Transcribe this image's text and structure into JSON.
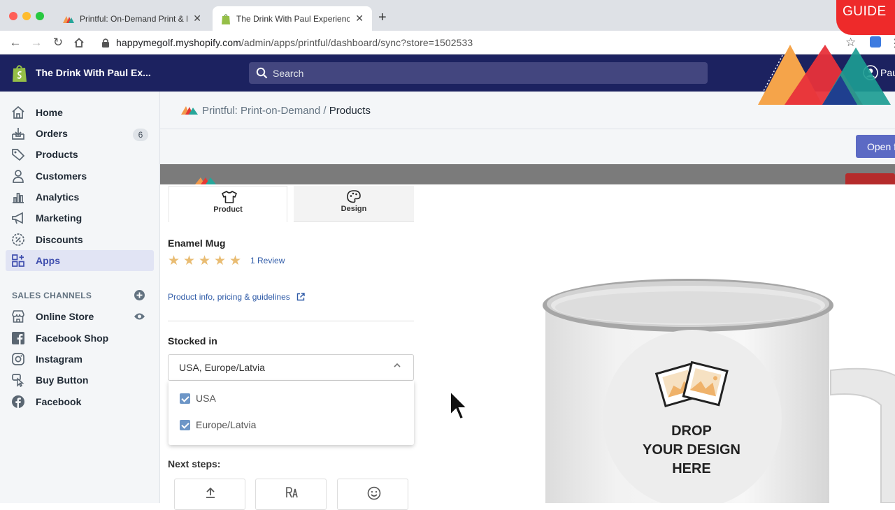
{
  "browser": {
    "tabs": [
      {
        "title": "Printful: On-Demand Print & En",
        "close": "✕"
      },
      {
        "title": "The Drink With Paul Experience",
        "close": "✕"
      }
    ],
    "new_tab": "+",
    "url_host": "happymegolf.myshopify.com",
    "url_path": "/admin/apps/printful/dashboard/sync?store=1502533"
  },
  "topbar": {
    "store_name": "The Drink With Paul Ex...",
    "search_placeholder": "Search",
    "user_name": "Pau"
  },
  "sidebar": {
    "items": [
      {
        "label": "Home",
        "icon": "home-icon"
      },
      {
        "label": "Orders",
        "icon": "orders-icon",
        "badge": "6"
      },
      {
        "label": "Products",
        "icon": "tag-icon"
      },
      {
        "label": "Customers",
        "icon": "person-icon"
      },
      {
        "label": "Analytics",
        "icon": "bar-chart-icon"
      },
      {
        "label": "Marketing",
        "icon": "megaphone-icon"
      },
      {
        "label": "Discounts",
        "icon": "discount-icon"
      },
      {
        "label": "Apps",
        "icon": "apps-icon",
        "active": true
      }
    ],
    "sales_channels_heading": "SALES CHANNELS",
    "channels": [
      {
        "label": "Online Store",
        "icon": "store-icon"
      },
      {
        "label": "Facebook Shop",
        "icon": "facebook-icon"
      },
      {
        "label": "Instagram",
        "icon": "instagram-icon"
      },
      {
        "label": "Buy Button",
        "icon": "buy-button-icon"
      },
      {
        "label": "Facebook",
        "icon": "facebook-round-icon"
      }
    ]
  },
  "header": {
    "app_name": "Printful: Print-on-Demand",
    "separator": "/",
    "current_page": "Products",
    "open_button": "Open f"
  },
  "editor": {
    "tabs": [
      {
        "label": "Product",
        "icon": "tshirt-icon"
      },
      {
        "label": "Design",
        "icon": "palette-icon"
      }
    ],
    "product_name": "Enamel Mug",
    "rating_stars": 5,
    "review_link": "1 Review",
    "info_link": "Product info, pricing & guidelines",
    "stocked_label": "Stocked in",
    "stocked_value": "USA, Europe/Latvia",
    "stock_options": [
      {
        "label": "USA",
        "checked": true
      },
      {
        "label": "Europe/Latvia",
        "checked": true
      }
    ],
    "next_steps_label": "Next steps:",
    "drop_text": [
      "DROP",
      "YOUR DESIGN",
      "HERE"
    ]
  },
  "overlay": {
    "guide_label": "GUIDE"
  },
  "colors": {
    "topbar": "#1c2260",
    "accent": "#5c6ac4",
    "star": "#e9bc72",
    "link": "#2e5aa7"
  }
}
